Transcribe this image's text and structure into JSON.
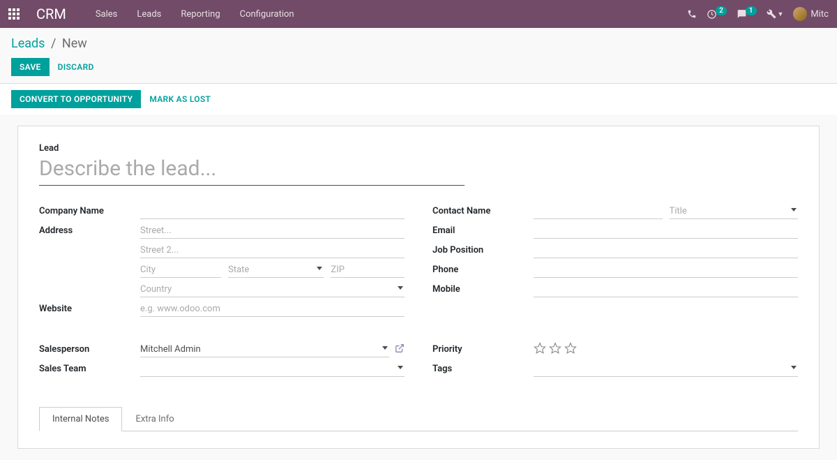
{
  "nav": {
    "brand": "CRM",
    "menu": [
      "Sales",
      "Leads",
      "Reporting",
      "Configuration"
    ],
    "clock_badge": "2",
    "chat_badge": "1",
    "username": "Mitc"
  },
  "breadcrumb": {
    "parent": "Leads",
    "current": "New"
  },
  "actions": {
    "save": "SAVE",
    "discard": "DISCARD"
  },
  "status_actions": {
    "convert": "CONVERT TO OPPORTUNITY",
    "lost": "MARK AS LOST"
  },
  "form": {
    "lead_label": "Lead",
    "lead_placeholder": "Describe the lead...",
    "left": {
      "company_name": "Company Name",
      "address": "Address",
      "street_ph": "Street...",
      "street2_ph": "Street 2...",
      "city_ph": "City",
      "state_ph": "State",
      "zip_ph": "ZIP",
      "country_ph": "Country",
      "website": "Website",
      "website_ph": "e.g. www.odoo.com",
      "salesperson": "Salesperson",
      "salesperson_value": "Mitchell Admin",
      "sales_team": "Sales Team"
    },
    "right": {
      "contact_name": "Contact Name",
      "title_ph": "Title",
      "email": "Email",
      "job_position": "Job Position",
      "phone": "Phone",
      "mobile": "Mobile",
      "priority": "Priority",
      "tags": "Tags"
    }
  },
  "tabs": [
    "Internal Notes",
    "Extra Info"
  ]
}
